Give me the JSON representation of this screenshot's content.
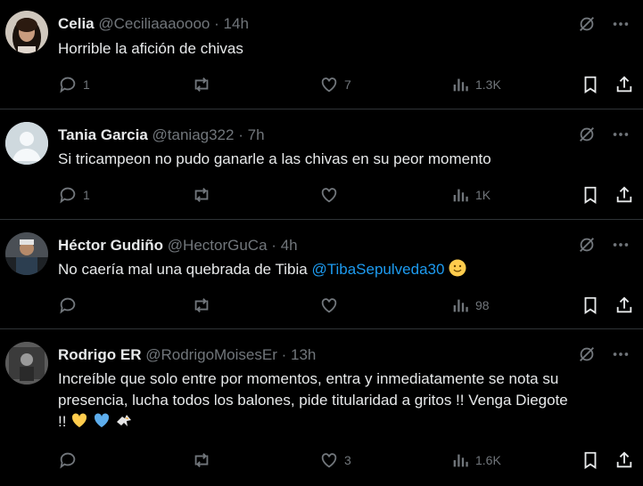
{
  "tweets": [
    {
      "name": "Celia",
      "handle": "@Ceciliaaaoooo",
      "time": "14h",
      "text": "Horrible la afición de chivas",
      "replies": "1",
      "retweets": "",
      "likes": "7",
      "views": "1.3K"
    },
    {
      "name": "Tania Garcia",
      "handle": "@taniag322",
      "time": "7h",
      "text": "Si tricampeon no pudo ganarle a las chivas en su peor momento",
      "replies": "1",
      "retweets": "",
      "likes": "",
      "views": "1K"
    },
    {
      "name": "Héctor Gudiño",
      "handle": "@HectorGuCa",
      "time": "4h",
      "text": "No caería mal una quebrada de Tibia",
      "mention": "@TibaSepulveda30",
      "emoji": "slightly-smiling-face",
      "replies": "",
      "retweets": "",
      "likes": "",
      "views": "98"
    },
    {
      "name": "Rodrigo ER",
      "handle": "@RodrigoMoisesEr",
      "time": "13h",
      "line1": "Increíble que solo entre por momentos, entra y inmediatamente se nota su",
      "line2": "presencia, lucha todos los balones, pide titularidad a gritos !! Venga Diegote",
      "line3": "!!",
      "emojis": [
        "yellow-heart",
        "blue-heart",
        "eagle"
      ],
      "replies": "",
      "retweets": "",
      "likes": "3",
      "views": "1.6K"
    }
  ],
  "separator": "·",
  "colors": {
    "background": "#000000",
    "text": "#e7e9ea",
    "muted": "#71767b",
    "link": "#1d9bf0",
    "border": "#2f3336"
  }
}
